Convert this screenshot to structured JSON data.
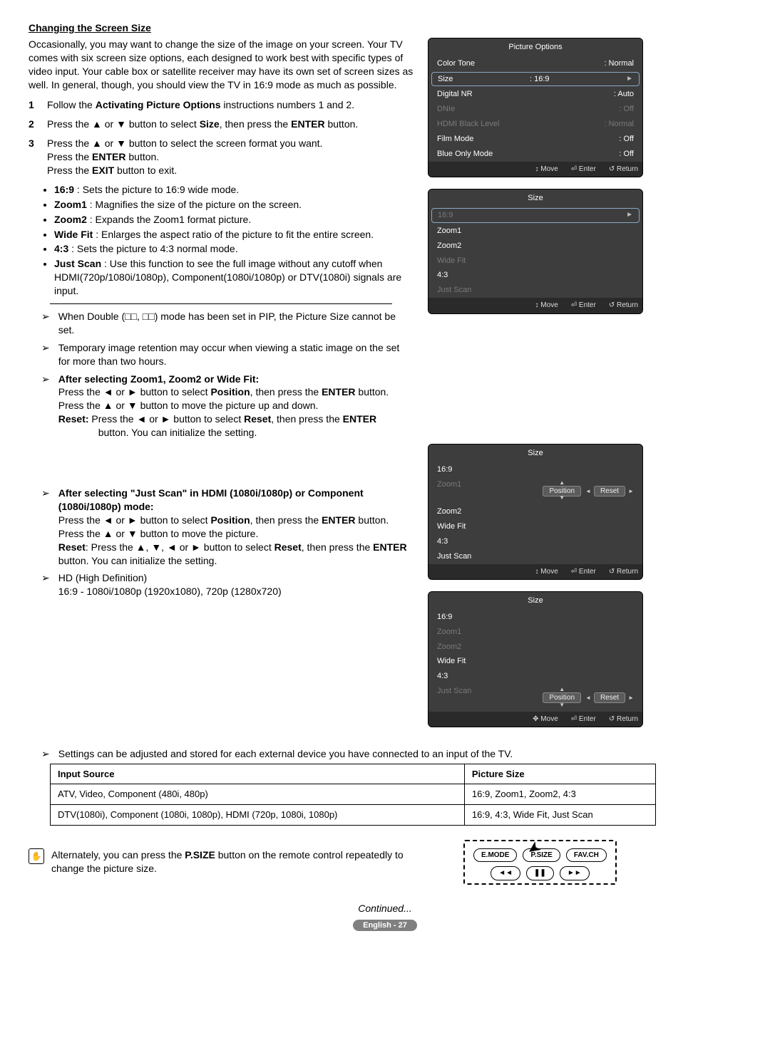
{
  "heading": "Changing the Screen Size",
  "intro": "Occasionally, you may want to change the size of the image on your screen. Your TV comes with six screen size options, each designed to work best with specific types of video input. Your cable box or satellite receiver may have its own set of screen sizes as well. In general, though, you should view the TV in 16:9 mode as much as possible.",
  "steps": {
    "s1_a": "Follow the ",
    "s1_b": "Activating Picture Options",
    "s1_c": " instructions numbers 1 and 2.",
    "s2_a": "Press the ▲ or ▼ button to select ",
    "s2_b": "Size",
    "s2_c": ", then press the ",
    "s2_d": "ENTER",
    "s2_e": " button.",
    "s3_l1": "Press the ▲ or ▼ button to select the screen format you want.",
    "s3_l2a": "Press the ",
    "s3_l2b": "ENTER",
    "s3_l2c": " button.",
    "s3_l3a": "Press the ",
    "s3_l3b": "EXIT",
    "s3_l3c": " button to exit."
  },
  "modes": [
    {
      "b": "16:9",
      "t": " : Sets the picture to 16:9 wide mode."
    },
    {
      "b": "Zoom1",
      "t": " : Magnifies the size of the picture on the screen."
    },
    {
      "b": "Zoom2",
      "t": " : Expands the Zoom1 format picture."
    },
    {
      "b": "Wide Fit",
      "t": " : Enlarges the aspect ratio of the picture to fit the entire screen."
    },
    {
      "b": "4:3",
      "t": " : Sets the picture to 4:3 normal mode."
    },
    {
      "b": "Just Scan",
      "t": " : Use this function to see the full image without any cutoff when HDMI(720p/1080i/1080p), Component(1080i/1080p) or DTV(1080i) signals are input."
    }
  ],
  "notes": {
    "n1": "When Double (□□, □□) mode has been set in PIP, the Picture Size cannot be set.",
    "n2": "Temporary image retention may occur when viewing a static image on the set for more than two hours.",
    "n3_title": "After selecting Zoom1, Zoom2 or Wide Fit",
    "n3_l1a": "Press the ◄ or ► button to select ",
    "n3_l1b": "Position",
    "n3_l1c": ", then press the ",
    "n3_l1d": "ENTER",
    "n3_l1e": " button.",
    "n3_l2": "Press the ▲ or ▼ button to move the picture up and down.",
    "n3_l3a": "Reset:",
    "n3_l3b": " Press the ◄ or ► button to select ",
    "n3_l3c": "Reset",
    "n3_l3d": ", then press the ",
    "n3_l3e": "ENTER",
    "n3_l3f": " button. You can initialize the setting.",
    "n4_title": "After selecting \"Just Scan\" in HDMI (1080i/1080p) or Component (1080i/1080p) mode",
    "n4_l1a": "Press the ◄ or ► button to select ",
    "n4_l1b": "Position",
    "n4_l1c": ", then press the ",
    "n4_l1d": "ENTER",
    "n4_l1e": " button.",
    "n4_l2": "Press the ▲ or ▼ button to move the picture.",
    "n4_l3a": "Reset",
    "n4_l3b": ": Press the ▲, ▼, ◄ or ► button to select ",
    "n4_l3c": "Reset",
    "n4_l3d": ", then press the ",
    "n4_l3e": "ENTER",
    "n4_l3f": " button. You can initialize the setting.",
    "n5": "HD (High Definition)",
    "n5b": "16:9 - 1080i/1080p (1920x1080), 720p (1280x720)",
    "n6": "Settings can be adjusted and stored for each external device you have connected to an input of the TV."
  },
  "table": {
    "h1": "Input Source",
    "h2": "Picture Size",
    "r1c1": "ATV, Video, Component (480i, 480p)",
    "r1c2": "16:9, Zoom1, Zoom2, 4:3",
    "r2c1": "DTV(1080i), Component (1080i, 1080p), HDMI (720p, 1080i, 1080p)",
    "r2c2": "16:9, 4:3, Wide Fit, Just Scan"
  },
  "tip_a": "Alternately, you can press the ",
  "tip_b": "P.SIZE",
  "tip_c": " button on the remote control repeatedly to change the picture size.",
  "remote": {
    "b1": "E.MODE",
    "b2": "P.SIZE",
    "b3": "FAV.CH",
    "b4": "◄◄",
    "b5": "❚❚",
    "b6": "►►"
  },
  "continued": "Continued...",
  "pagefoot": "English - 27",
  "osd1": {
    "title": "Picture Options",
    "items": [
      {
        "l": "Color Tone",
        "v": ": Normal"
      },
      {
        "l": "Size",
        "v": ": 16:9"
      },
      {
        "l": "Digital NR",
        "v": ": Auto"
      },
      {
        "l": "DNIe",
        "v": ": Off"
      },
      {
        "l": "HDMI Black Level",
        "v": ": Normal"
      },
      {
        "l": "Film Mode",
        "v": ": Off"
      },
      {
        "l": "Blue Only Mode",
        "v": ": Off"
      }
    ],
    "foot": {
      "m": "↕ Move",
      "e": "⏎ Enter",
      "r": "↺ Return"
    }
  },
  "osd2": {
    "title": "Size",
    "items": [
      "16:9",
      "Zoom1",
      "Zoom2",
      "Wide Fit",
      "4:3",
      "Just Scan"
    ],
    "foot": {
      "m": "↕ Move",
      "e": "⏎ Enter",
      "r": "↺ Return"
    }
  },
  "osd3": {
    "title": "Size",
    "items": [
      "16:9",
      "Zoom1",
      "Zoom2",
      "Wide Fit",
      "4:3",
      "Just Scan"
    ],
    "btnPos": "Position",
    "btnReset": "Reset",
    "foot": {
      "m": "↕ Move",
      "e": "⏎ Enter",
      "r": "↺ Return"
    }
  },
  "osd4": {
    "title": "Size",
    "items": [
      "16:9",
      "Zoom1",
      "Zoom2",
      "Wide Fit",
      "4:3",
      "Just Scan"
    ],
    "btnPos": "Position",
    "btnReset": "Reset",
    "foot": {
      "m": "✥ Move",
      "e": "⏎ Enter",
      "r": "↺ Return"
    }
  }
}
